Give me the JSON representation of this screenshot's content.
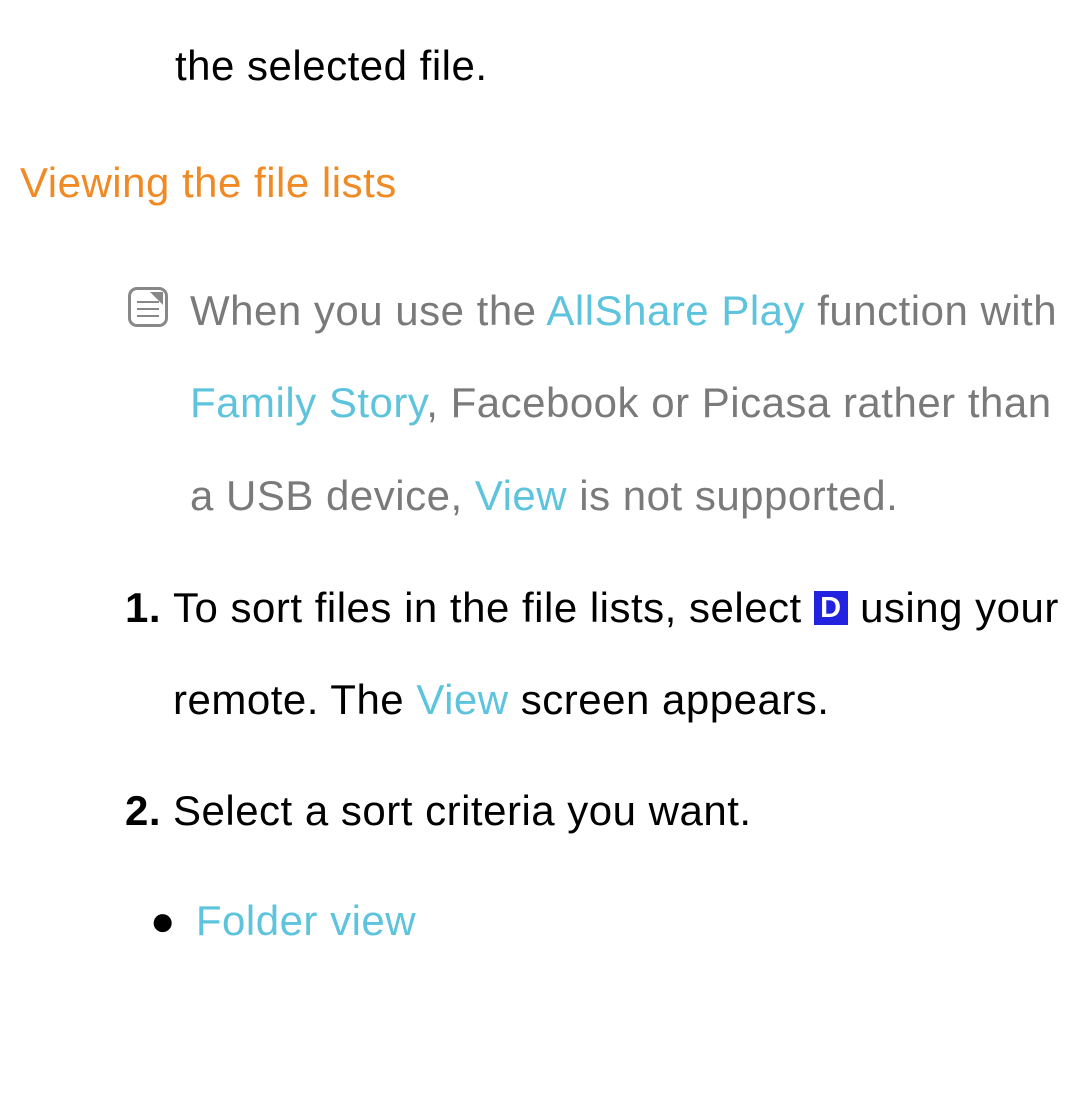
{
  "continuation": "the selected file.",
  "heading": "Viewing the file lists",
  "note": {
    "part1": "When you use the ",
    "hl1": "AllShare Play",
    "part2": " function with ",
    "hl2": "Family Story",
    "part3": ", Facebook or Picasa rather than a USB device, ",
    "hl3": "View",
    "part4": " is not supported."
  },
  "steps": {
    "s1": {
      "num": "1.",
      "part1": "To sort files in the file lists, select ",
      "icon": "D",
      "part2": " using your remote. The ",
      "hl1": "View",
      "part3": " screen appears."
    },
    "s2": {
      "num": "2.",
      "text": "Select a sort criteria you want."
    }
  },
  "bullet": {
    "dot": "●",
    "label": "Folder view"
  }
}
